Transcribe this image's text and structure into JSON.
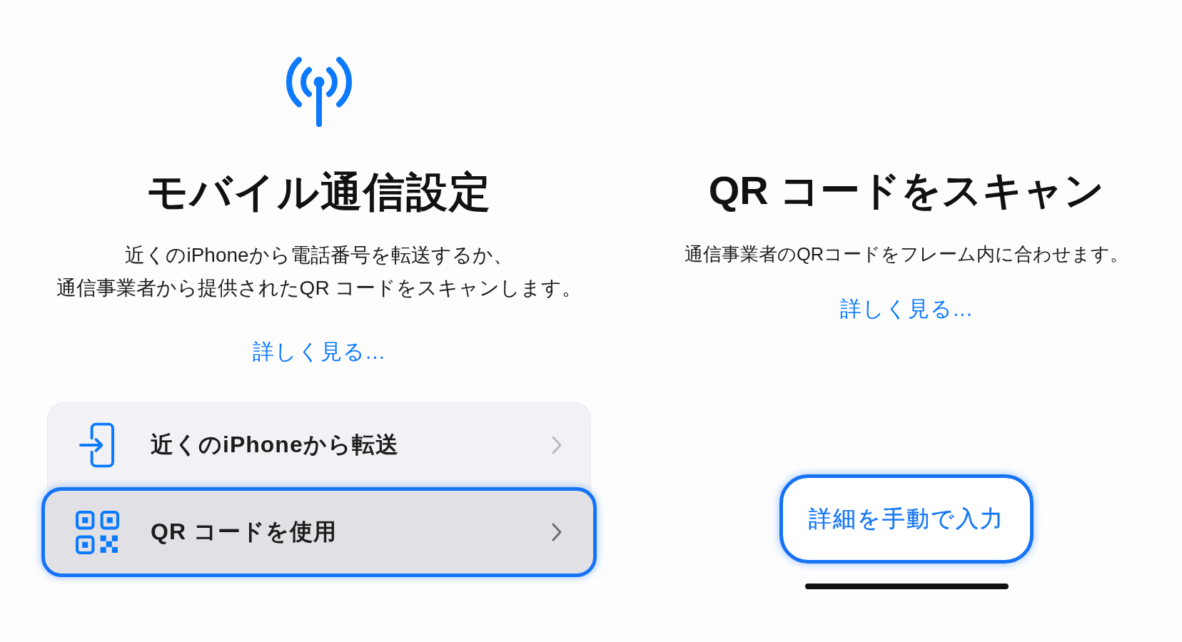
{
  "setup": {
    "title": "モバイル通信設定",
    "description_lines": [
      "近くのiPhoneから電話番号を転送するか、",
      "通信事業者から提供されたQR コードをスキャンします。"
    ],
    "learn_more": "詳しく見る...",
    "options": [
      {
        "kind": "transfer",
        "label": "近くのiPhoneから転送",
        "selected": false
      },
      {
        "kind": "qr",
        "label": "QR コードを使用",
        "selected": true
      }
    ]
  },
  "scan": {
    "title": "QR コードをスキャン",
    "description": "通信事業者のQRコードをフレーム内に合わせます。",
    "learn_more": "詳しく見る...",
    "manual_button": {
      "label": "詳細を手動で入力",
      "focused": true
    }
  }
}
